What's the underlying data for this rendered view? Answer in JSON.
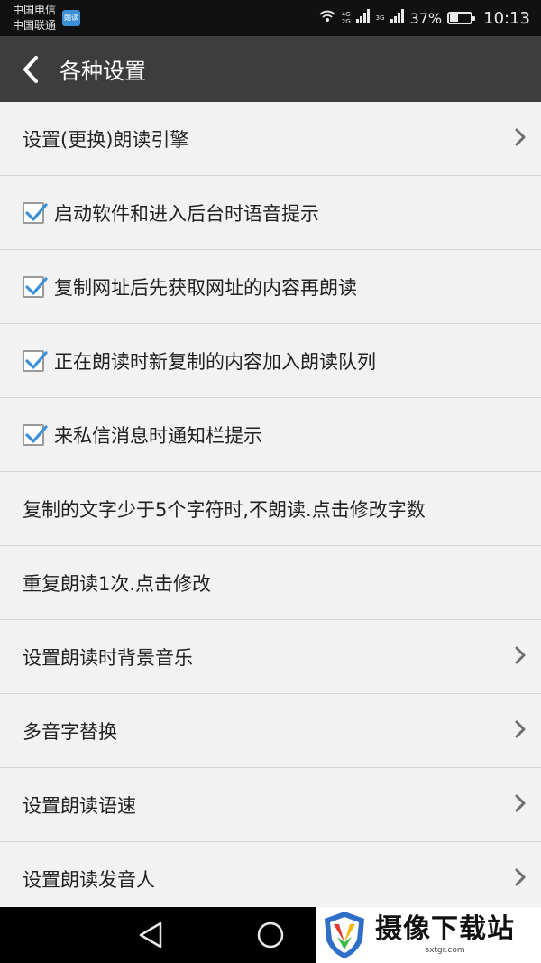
{
  "status_bar": {
    "carrier_1": "中国电信",
    "carrier_2": "中国联通",
    "app_badge": "朗读",
    "net_sim1_top": "2",
    "net_sim1_label_top": "4G",
    "net_sim1_label_bottom": "2G",
    "net_sim2_label": "3G",
    "battery_percent": "37%",
    "battery_level": 0.37,
    "time": "10:13",
    "icons": [
      "wifi-hotspot-icon",
      "signal-icon",
      "signal-icon",
      "battery-icon"
    ]
  },
  "action_bar": {
    "back_icon": "chevron-left-icon",
    "title": "各种设置"
  },
  "settings": [
    {
      "label": "设置(更换)朗读引擎",
      "type": "nav",
      "icon": "chevron-right-icon"
    },
    {
      "label": "启动软件和进入后台时语音提示",
      "type": "checkbox",
      "checked": true
    },
    {
      "label": "复制网址后先获取网址的内容再朗读",
      "type": "checkbox",
      "checked": true
    },
    {
      "label": "正在朗读时新复制的内容加入朗读队列",
      "type": "checkbox",
      "checked": true
    },
    {
      "label": "来私信消息时通知栏提示",
      "type": "checkbox",
      "checked": true
    },
    {
      "label": "复制的文字少于5个字符时,不朗读.点击修改字数",
      "type": "text"
    },
    {
      "label": "重复朗读1次.点击修改",
      "type": "text"
    },
    {
      "label": "设置朗读时背景音乐",
      "type": "nav",
      "icon": "chevron-right-icon"
    },
    {
      "label": "多音字替换",
      "type": "nav",
      "icon": "chevron-right-icon"
    },
    {
      "label": "设置朗读语速",
      "type": "nav",
      "icon": "chevron-right-icon"
    },
    {
      "label": "设置朗读发音人",
      "type": "nav",
      "icon": "chevron-right-icon"
    }
  ],
  "nav_bar": {
    "back": "triangle-back-icon",
    "home": "circle-home-icon"
  },
  "watermark": {
    "title": "摄像下载站",
    "url": "sxtgr.com"
  },
  "colors": {
    "action_bar": "#3d3d3d",
    "status_bar": "#111111",
    "check_blue": "#3a8fd6",
    "list_bg": "#f2f2f2"
  }
}
